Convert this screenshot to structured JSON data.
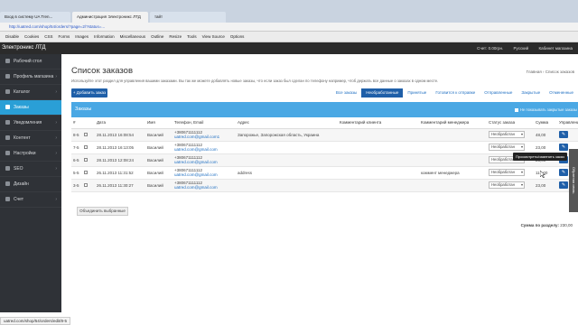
{
  "browser": {
    "tabs": [
      "Вход в систему UA Tren...",
      "Администрация Электроникс ЛТД",
      "тайт"
    ],
    "url": "http://uatred.com/shop/54/orders/?page=2/?status=...",
    "bookmarks": [
      "Disable",
      "Cookies",
      "CSS",
      "Forms",
      "Images",
      "Information",
      "Miscellaneous",
      "Outline",
      "Resize",
      "Tools",
      "View Source",
      "Options"
    ],
    "status_url": "uatred.com/shop/54/orders/edit/8-5"
  },
  "header": {
    "brand": "Электроникс ЛТД",
    "balance": "Счет: 0.00грн.",
    "language": "Русский",
    "cabinet": "Кабинет магазина"
  },
  "sidebar": {
    "items": [
      {
        "label": "Рабочий стол",
        "chevron": false
      },
      {
        "label": "Профиль магазина",
        "chevron": true
      },
      {
        "label": "Каталог",
        "chevron": true
      },
      {
        "label": "Заказы",
        "chevron": false
      },
      {
        "label": "Уведомления",
        "chevron": true
      },
      {
        "label": "Контент",
        "chevron": true
      },
      {
        "label": "Настройки",
        "chevron": true
      },
      {
        "label": "SEO",
        "chevron": true
      },
      {
        "label": "Дизайн",
        "chevron": false
      },
      {
        "label": "Счет",
        "chevron": true
      }
    ],
    "active_index": 3
  },
  "page": {
    "title": "Список заказов",
    "description": "Используйте этот раздел для управления вашими заказами. Вы так же можете добавлять новые заказы, что если заказ был сделан по телефону например, чтоб держать все данные о заказах в одном месте.",
    "breadcrumb": "Главная › Список заказов",
    "add_button": "+ Добавить заказ",
    "filters": [
      "Все заказы",
      "Необработанные",
      "Принятые",
      "Готовится к отправке",
      "Отправленные",
      "Закрытые",
      "Отмененные"
    ],
    "active_filter": 1
  },
  "panel": {
    "title": "Заказы",
    "toggle_label": "Не показывать закрытые заказы"
  },
  "table": {
    "columns": [
      "#",
      "",
      "Дата",
      "Имя",
      "Телефон, Email",
      "Адрес",
      "Комментарий клиента",
      "Комментарий менеджера",
      "Статус заказа",
      "Сумма",
      "Управление"
    ],
    "rows": [
      {
        "id": "8-5",
        "date": "28.11.2013 16:08:54",
        "name": "Василий",
        "phone": "+380671111112",
        "email": "uatred.com@gmail.com1",
        "address": "Запорожье, Запорожская область, Украина",
        "client_comment": "",
        "manager_comment": "",
        "status": "Необработан",
        "sum": "48,00"
      },
      {
        "id": "7-5",
        "date": "28.11.2013 16:13:05",
        "name": "Василий",
        "phone": "+380671111112",
        "email": "uatred.com@gmail.com",
        "address": "",
        "client_comment": "",
        "manager_comment": "",
        "status": "Необработан",
        "sum": "23,00"
      },
      {
        "id": "6-5",
        "date": "28.11.2013 12:08:24",
        "name": "Василий",
        "phone": "+380671111112",
        "email": "uatred.com@gmail.com",
        "address": "",
        "client_comment": "",
        "manager_comment": "",
        "status": "Необработан",
        "sum": "23,00"
      },
      {
        "id": "5-5",
        "date": "26.11.2013 11:31:52",
        "name": "Василий",
        "phone": "+380671111112",
        "email": "uatred.com@gmail.com",
        "address": "address",
        "client_comment": "",
        "manager_comment": "коммент менеджера",
        "status": "Необработан",
        "sum": "115,00"
      },
      {
        "id": "3-5",
        "date": "26.11.2013 11:30:27",
        "name": "Василий",
        "phone": "+380671111112",
        "email": "uatred.com@gmail.com",
        "address": "",
        "client_comment": "",
        "manager_comment": "",
        "status": "Необработан",
        "sum": "23,00"
      }
    ]
  },
  "tooltip": "Просмотреть/изменить заказ",
  "merge_button": "Объединить выбранные",
  "total": {
    "label": "Сумма по разделу:",
    "value": "230,00"
  },
  "side_tab": "Обратная связь",
  "colors": {
    "accent": "#1f5fa8",
    "panel": "#4aa8e4",
    "sidebar": "#2f3237",
    "sidebar_active": "#2a9fd6"
  },
  "icons": {
    "edit": "pencil-icon",
    "breadcrumb": "home-icon"
  }
}
